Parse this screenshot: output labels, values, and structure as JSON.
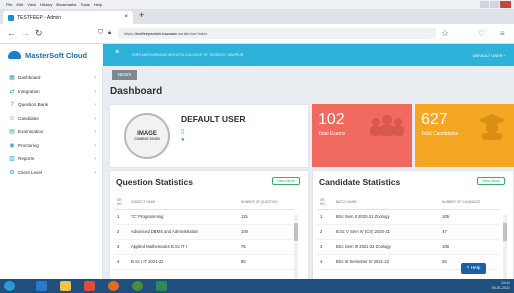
{
  "browser": {
    "menu": [
      "File",
      "Edit",
      "View",
      "History",
      "Bookmarks",
      "Tools",
      "Help"
    ],
    "tab_title": "TESTFEEP - Admin",
    "url_prefix": "https://",
    "url_domain": "testfeepadmin.bawaam.co.in",
    "url_path": "/User/Index",
    "new_tab": "+",
    "close_tab": "×"
  },
  "app": {
    "brand": "MasterSoft Cloud",
    "college": "SHRI MATHURADAS MOHOTA COLLEGE OF SCIENCE, NAGPUR",
    "user_menu": "DEFAULT USER"
  },
  "sidebar": {
    "items": [
      {
        "label": "Dashboard",
        "icon": "dashboard-icon"
      },
      {
        "label": "Integration",
        "icon": "integration-icon"
      },
      {
        "label": "Question Bank",
        "icon": "question-bank-icon"
      },
      {
        "label": "Candidate",
        "icon": "candidate-icon"
      },
      {
        "label": "Examination",
        "icon": "examination-icon"
      },
      {
        "label": "Proctoring",
        "icon": "proctoring-icon"
      },
      {
        "label": "Reports",
        "icon": "reports-icon"
      },
      {
        "label": "Client Level",
        "icon": "client-level-icon"
      }
    ]
  },
  "breadcrumb": "NEWS",
  "page_title": "Dashboard",
  "profile": {
    "name": "DEFAULT USER",
    "avatar_text_1": "IMAGE",
    "avatar_text_2": "COMING SOON"
  },
  "stats": {
    "total_exams": {
      "value": "102",
      "label": "Total Exams"
    },
    "total_candidates": {
      "value": "627",
      "label": "Total Candidates"
    }
  },
  "question_stats": {
    "title": "Question Statistics",
    "view_more": "View More",
    "columns": [
      "SR. NO.",
      "SUBJECT NAME",
      "NUMBER OF QUESTION"
    ],
    "rows": [
      [
        "1",
        "\"C\" Programming",
        "115"
      ],
      [
        "2",
        "Advanced DBMS and Administration",
        "100"
      ],
      [
        "3",
        "Applied Mathematics B.Sc IT I",
        "75"
      ],
      [
        "4",
        "B.Sc I IT 2021-22",
        "85"
      ]
    ]
  },
  "candidate_stats": {
    "title": "Candidate Statistics",
    "view_more": "View More",
    "columns": [
      "SR. NO.",
      "BATCH NAME",
      "NUMBER OF CANDIDATE"
    ],
    "rows": [
      [
        "1",
        "BSc Sem II 2020-21 Zoology",
        "105"
      ],
      [
        "2",
        "B.Sc V Sem IV (CS) 2020-21",
        "47"
      ],
      [
        "3",
        "BSc Sem III 2021-22 Zoology",
        "108"
      ],
      [
        "4",
        "BSc III Semester IV 2021-22",
        "26"
      ]
    ]
  },
  "help": "Help",
  "taskbar": {
    "time": "13:41",
    "date": "09-01-2021"
  },
  "colors": {
    "accent": "#2eb2d9",
    "exams": "#f06a5f",
    "candidates": "#f5a623",
    "view_more": "#35b06b"
  }
}
